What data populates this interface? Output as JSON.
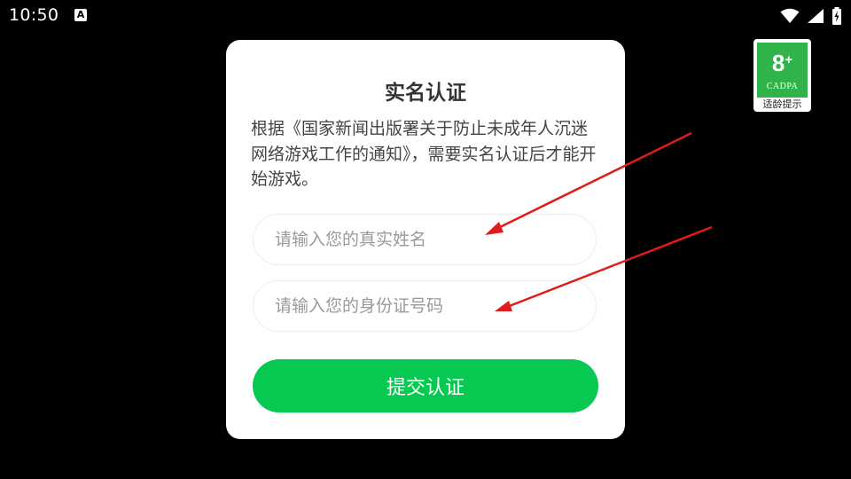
{
  "status_bar": {
    "time": "10:50",
    "notification_icon": "a-icon",
    "icons": [
      "wifi-icon",
      "signal-icon",
      "battery-charging-icon"
    ]
  },
  "dialog": {
    "title": "实名认证",
    "description": "根据《国家新闻出版署关于防止未成年人沉迷网络游戏工作的通知》，需要实名认证后才能开始游戏。",
    "name_field": {
      "placeholder": "请输入您的真实姓名",
      "value": ""
    },
    "id_field": {
      "placeholder": "请输入您的身份证号码",
      "value": ""
    },
    "submit_label": "提交认证"
  },
  "age_badge": {
    "rating": "8",
    "plus": "+",
    "org": "CADPA",
    "tip": "适龄提示"
  },
  "colors": {
    "background": "#000000",
    "card": "#ffffff",
    "accent_green": "#07c851",
    "arrow_red": "#e01b1b"
  }
}
